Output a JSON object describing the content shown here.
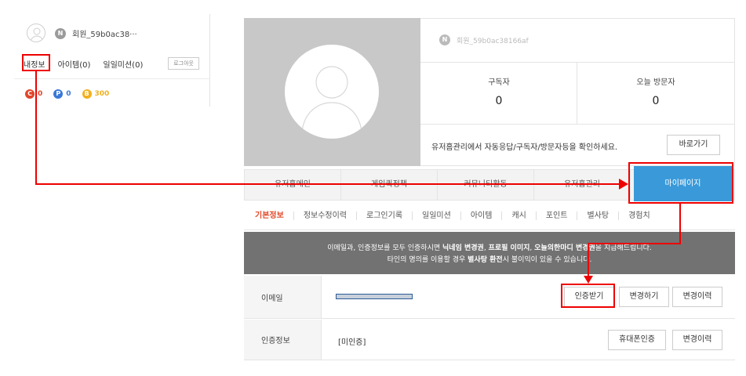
{
  "mini": {
    "name_badge": "N",
    "name": "회원_59b0ac38···",
    "tabs": [
      "내정보",
      "아이템(0)",
      "일일미션(0)"
    ],
    "logout": "로그아웃",
    "currencies": [
      {
        "icon": "C",
        "value": "0",
        "color": "#e0452b"
      },
      {
        "icon": "P",
        "value": "0",
        "color": "#3a78d8"
      },
      {
        "icon": "B",
        "value": "300",
        "color": "#f2b01e"
      }
    ]
  },
  "profile": {
    "name_badge": "N",
    "name": "회원_59b0ac38166af",
    "stats": [
      {
        "label": "구독자",
        "value": "0"
      },
      {
        "label": "오늘 방문자",
        "value": "0"
      }
    ],
    "message": "유저홈관리에서 자동응답/구독자/방문자등을 확인하세요.",
    "shortcut_button": "바로가기"
  },
  "nav": {
    "items": [
      "유저홈메인",
      "게임퀵정책",
      "커뮤니티활동",
      "유저홈관리"
    ],
    "active": "마이페이지"
  },
  "subnav": [
    "기본정보",
    "정보수정이력",
    "로그인기록",
    "일일미션",
    "아이템",
    "캐시",
    "포인트",
    "별사탕",
    "경험치"
  ],
  "notice": {
    "line1_pre": "이메일과, 인증정보를 모두 인증하시면 ",
    "line1_bold1": "닉네임 변경권",
    "line1_sep1": ", ",
    "line1_bold2": "프로필 이미지",
    "line1_sep2": ", ",
    "line1_bold3": "오늘의한마디 변경권",
    "line1_post": "을 지급해드립니다.",
    "line2_pre": "타인의 명의를 이용할 경우 ",
    "line2_bold": "별사탕 환전",
    "line2_post": "시 불이익이 있을 수 있습니다."
  },
  "form": {
    "email": {
      "label": "이메일",
      "buttons": [
        "인증받기",
        "변경하기",
        "변경이력"
      ]
    },
    "auth": {
      "label": "인증정보",
      "value": "[미인증]",
      "buttons": [
        "휴대폰인증",
        "변경이력"
      ]
    }
  },
  "colors": {
    "accent": "#3a9ad9",
    "annotation": "#e00000",
    "notice_bg": "#727272"
  }
}
